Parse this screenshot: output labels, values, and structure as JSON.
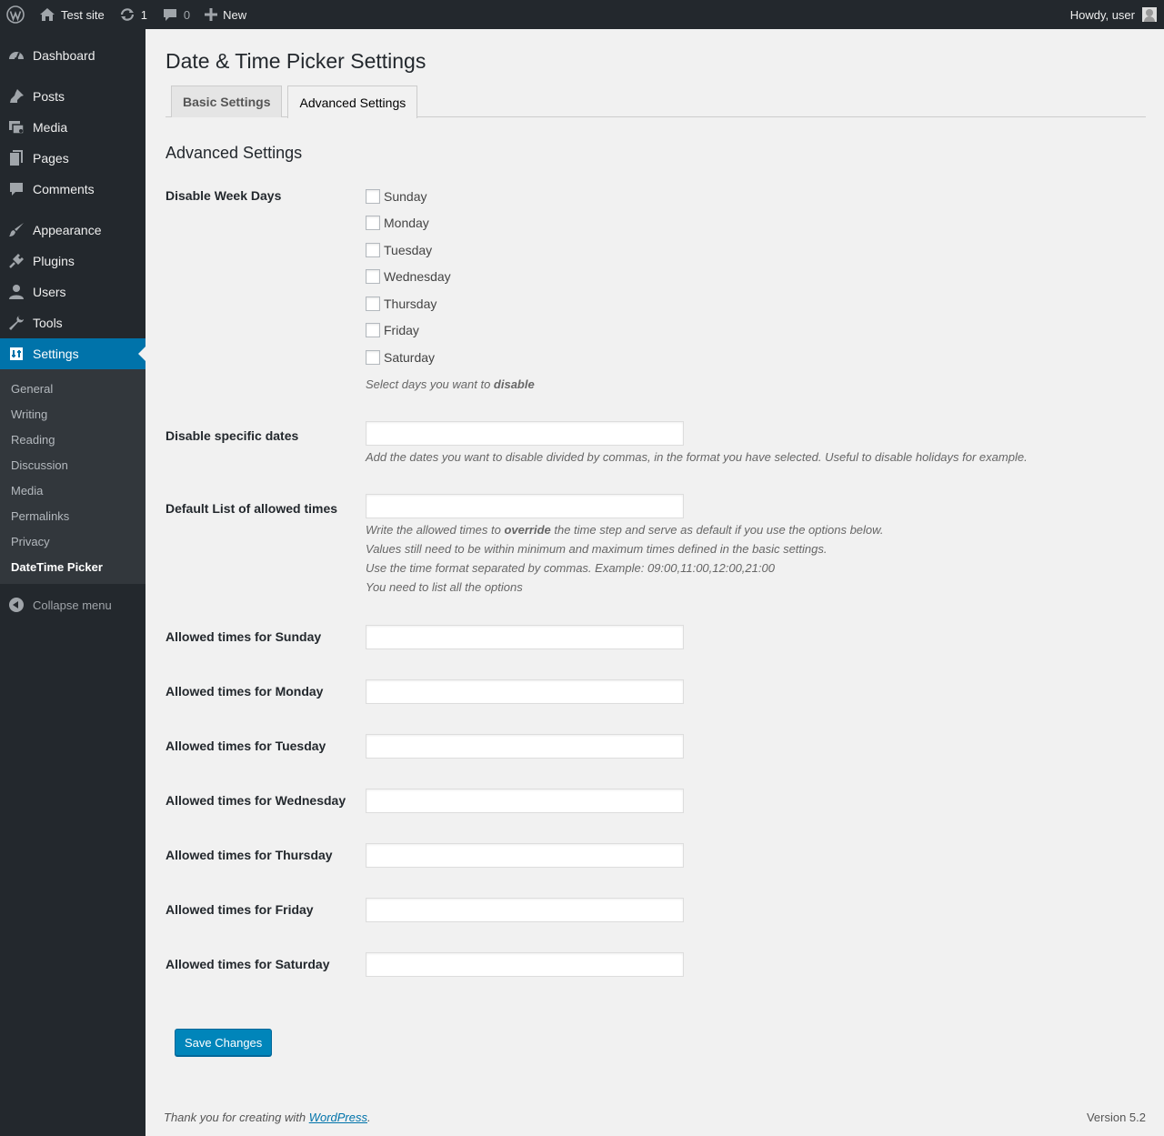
{
  "adminbar": {
    "site_name": "Test site",
    "updates_count": "1",
    "comments_count": "0",
    "new_label": "New",
    "howdy": "Howdy, user"
  },
  "sidebar": {
    "items": [
      {
        "label": "Dashboard",
        "icon": "dashboard-icon"
      },
      {
        "label": "Posts",
        "icon": "pin-icon"
      },
      {
        "label": "Media",
        "icon": "media-icon"
      },
      {
        "label": "Pages",
        "icon": "pages-icon"
      },
      {
        "label": "Comments",
        "icon": "comments-icon"
      },
      {
        "label": "Appearance",
        "icon": "brush-icon"
      },
      {
        "label": "Plugins",
        "icon": "plugin-icon"
      },
      {
        "label": "Users",
        "icon": "users-icon"
      },
      {
        "label": "Tools",
        "icon": "wrench-icon"
      },
      {
        "label": "Settings",
        "icon": "settings-icon"
      }
    ],
    "submenu": [
      "General",
      "Writing",
      "Reading",
      "Discussion",
      "Media",
      "Permalinks",
      "Privacy",
      "DateTime Picker"
    ],
    "collapse_label": "Collapse menu"
  },
  "page": {
    "title": "Date & Time Picker Settings",
    "tabs": [
      "Basic Settings",
      "Advanced Settings"
    ],
    "section_title": "Advanced Settings"
  },
  "form": {
    "weekdays_label": "Disable Week Days",
    "weekdays": [
      "Sunday",
      "Monday",
      "Tuesday",
      "Wednesday",
      "Thursday",
      "Friday",
      "Saturday"
    ],
    "weekdays_desc_prefix": "Select days you want to ",
    "weekdays_desc_bold": "disable",
    "dates_label": "Disable specific dates",
    "dates_value": "",
    "dates_desc": "Add the dates you want to disable divided by commas, in the format you have selected. Useful to disable holidays for example.",
    "times_label": "Default List of allowed times",
    "times_value": "",
    "times_desc_1_prefix": "Write the allowed times to ",
    "times_desc_1_bold": "override",
    "times_desc_1_suffix": " the time step and serve as default if you use the options below.",
    "times_desc_2": "Values still need to be within minimum and maximum times defined in the basic settings.",
    "times_desc_3": "Use the time format separated by commas. Example: 09:00,11:00,12:00,21:00",
    "times_desc_4": "You need to list all the options",
    "allowed_times": [
      {
        "label": "Allowed times for Sunday",
        "value": ""
      },
      {
        "label": "Allowed times for Monday",
        "value": ""
      },
      {
        "label": "Allowed times for Tuesday",
        "value": ""
      },
      {
        "label": "Allowed times for Wednesday",
        "value": ""
      },
      {
        "label": "Allowed times for Thursday",
        "value": ""
      },
      {
        "label": "Allowed times for Friday",
        "value": ""
      },
      {
        "label": "Allowed times for Saturday",
        "value": ""
      }
    ],
    "save_label": "Save Changes"
  },
  "footer": {
    "thanks_prefix": "Thank you for creating with ",
    "thanks_link": "WordPress",
    "thanks_suffix": ".",
    "version": "Version 5.2"
  },
  "colors": {
    "admin_dark": "#23282d",
    "submenu_bg": "#32373c",
    "accent": "#0073aa",
    "button": "#0085ba",
    "page_bg": "#f1f1f1"
  }
}
